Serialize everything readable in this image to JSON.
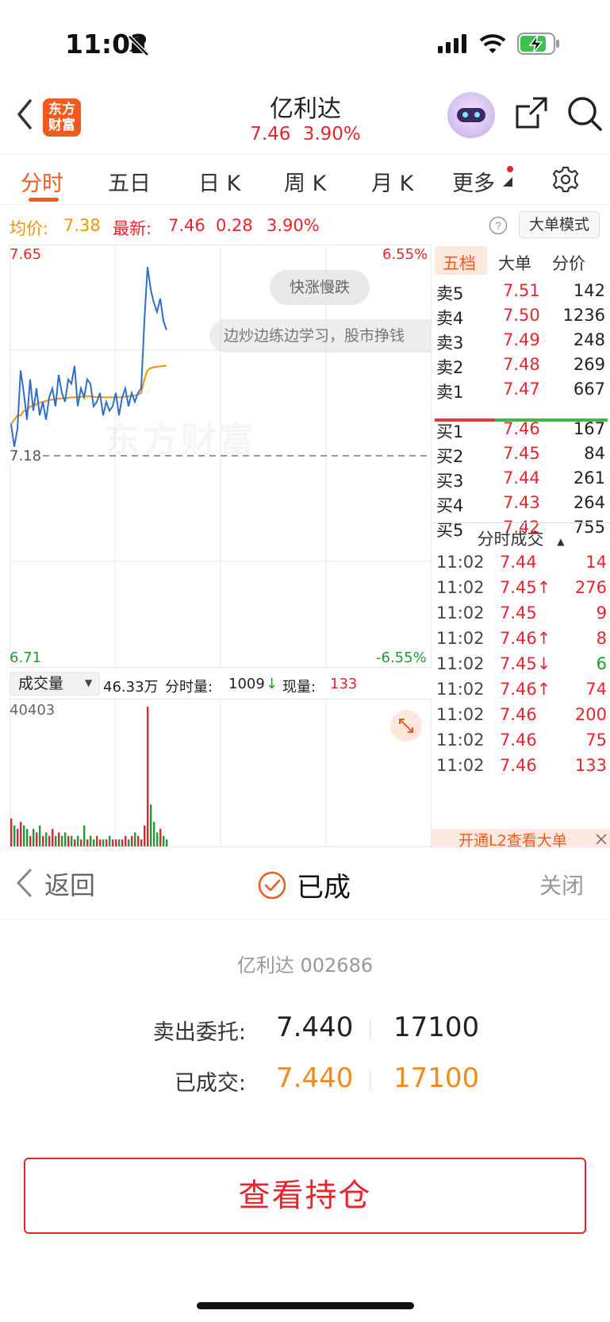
{
  "status_bar": {
    "time": "11:02"
  },
  "header": {
    "logo_text": "东方\n财富",
    "title": "亿利达",
    "price": "7.46",
    "change_pct": "3.90%"
  },
  "tabs": [
    {
      "label": "分时",
      "active": true
    },
    {
      "label": "五日"
    },
    {
      "label": "日 K"
    },
    {
      "label": "周 K"
    },
    {
      "label": "月 K"
    },
    {
      "label": "更多"
    }
  ],
  "price_info": {
    "avg_label": "均价:",
    "avg_value": "7.38",
    "latest_label": "最新:",
    "latest_value": "7.46",
    "change_value": "0.28",
    "change_pct": "3.90%",
    "mode_button": "大单模式"
  },
  "chart": {
    "y_top": "7.65",
    "y_mid": "7.18",
    "y_bottom": "6.71",
    "pct_top": "6.55%",
    "pct_bottom": "-6.55%",
    "tag": "快涨慢跌",
    "ticker_text": "边炒边练边学习，股市挣钱",
    "watermark": "东方财富",
    "volume_selector": "成交量",
    "volume_total": "46.33万",
    "volume_detail_label": "分时量:",
    "volume_detail_value": "1009",
    "current_label": "现量:",
    "current_value": "133",
    "volume_max": "40403"
  },
  "chart_data": {
    "type": "line",
    "series": [
      {
        "values": [
          7.25,
          7.2,
          7.24,
          7.37,
          7.32,
          7.26,
          7.35,
          7.28,
          7.33,
          7.27,
          7.3,
          7.26,
          7.31,
          7.33,
          7.29,
          7.36,
          7.32,
          7.3,
          7.35,
          7.34,
          7.38,
          7.29,
          7.33,
          7.31,
          7.35,
          7.34,
          7.29,
          7.3,
          7.32,
          7.27,
          7.3,
          7.28,
          7.29,
          7.32,
          7.27,
          7.31,
          7.33,
          7.29,
          7.32,
          7.3,
          7.32,
          7.33,
          7.48,
          7.6,
          7.55,
          7.52,
          7.5,
          7.53,
          7.48,
          7.46
        ]
      },
      {
        "values": [
          7.25,
          7.26,
          7.27,
          7.27,
          7.28,
          7.28,
          7.29,
          7.29,
          7.295,
          7.298,
          7.3,
          7.302,
          7.304,
          7.305,
          7.306,
          7.307,
          7.308,
          7.308,
          7.309,
          7.31,
          7.31,
          7.311,
          7.311,
          7.312,
          7.312,
          7.312,
          7.311,
          7.311,
          7.311,
          7.31,
          7.31,
          7.31,
          7.31,
          7.31,
          7.31,
          7.31,
          7.312,
          7.312,
          7.313,
          7.314,
          7.316,
          7.32,
          7.35,
          7.37,
          7.375,
          7.377,
          7.378,
          7.379,
          7.38,
          7.38
        ]
      }
    ],
    "ylim": [
      6.71,
      7.65
    ],
    "volumes": [
      8,
      6,
      5,
      7,
      6,
      5,
      3,
      5,
      4,
      6,
      3,
      4,
      3,
      5,
      3,
      4,
      3,
      4,
      3,
      3,
      2,
      3,
      2,
      6,
      2,
      3,
      2,
      3,
      2,
      2,
      2,
      3,
      2,
      2,
      2,
      2,
      3,
      2,
      3,
      4,
      3,
      2,
      6,
      40,
      12,
      7,
      4,
      5,
      3,
      2
    ]
  },
  "order_book": {
    "tabs": [
      "五档",
      "大单",
      "分价"
    ],
    "asks": [
      {
        "label": "卖5",
        "price": "7.51",
        "vol": "142"
      },
      {
        "label": "卖4",
        "price": "7.50",
        "vol": "1236"
      },
      {
        "label": "卖3",
        "price": "7.49",
        "vol": "248"
      },
      {
        "label": "卖2",
        "price": "7.48",
        "vol": "269"
      },
      {
        "label": "卖1",
        "price": "7.47",
        "vol": "667"
      }
    ],
    "bids": [
      {
        "label": "买1",
        "price": "7.46",
        "vol": "167"
      },
      {
        "label": "买2",
        "price": "7.45",
        "vol": "84"
      },
      {
        "label": "买3",
        "price": "7.44",
        "vol": "261"
      },
      {
        "label": "买4",
        "price": "7.43",
        "vol": "264"
      },
      {
        "label": "买5",
        "price": "7.42",
        "vol": "755"
      }
    ],
    "trades_title": "分时成交",
    "trades": [
      {
        "time": "11:02",
        "price": "7.44",
        "vol": "14",
        "pc": "red",
        "vc": "red"
      },
      {
        "time": "11:02",
        "price": "7.45↑",
        "vol": "276",
        "pc": "red",
        "vc": "red"
      },
      {
        "time": "11:02",
        "price": "7.45",
        "vol": "9",
        "pc": "red",
        "vc": "red"
      },
      {
        "time": "11:02",
        "price": "7.46↑",
        "vol": "8",
        "pc": "red",
        "vc": "red"
      },
      {
        "time": "11:02",
        "price": "7.45↓",
        "vol": "6",
        "pc": "red",
        "vc": "green"
      },
      {
        "time": "11:02",
        "price": "7.46↑",
        "vol": "74",
        "pc": "red",
        "vc": "red"
      },
      {
        "time": "11:02",
        "price": "7.46",
        "vol": "200",
        "pc": "red",
        "vc": "red"
      },
      {
        "time": "11:02",
        "price": "7.46",
        "vol": "75",
        "pc": "red",
        "vc": "red"
      },
      {
        "time": "11:02",
        "price": "7.46",
        "vol": "133",
        "pc": "red",
        "vc": "red"
      }
    ],
    "upsell": "开通L2查看大单"
  },
  "sheet": {
    "back": "返回",
    "status": "已成",
    "close": "关闭",
    "stock": "亿利达 002686",
    "sell_label": "卖出委托:",
    "sell_price": "7.440",
    "sell_qty": "17100",
    "filled_label": "已成交:",
    "filled_price": "7.440",
    "filled_qty": "17100",
    "view_button": "查看持仓"
  },
  "colors": {
    "up": "#e8242c",
    "down": "#1a9e2e",
    "accent": "#f05a1e",
    "avg": "#f39400",
    "line": "#2f6fc8"
  }
}
